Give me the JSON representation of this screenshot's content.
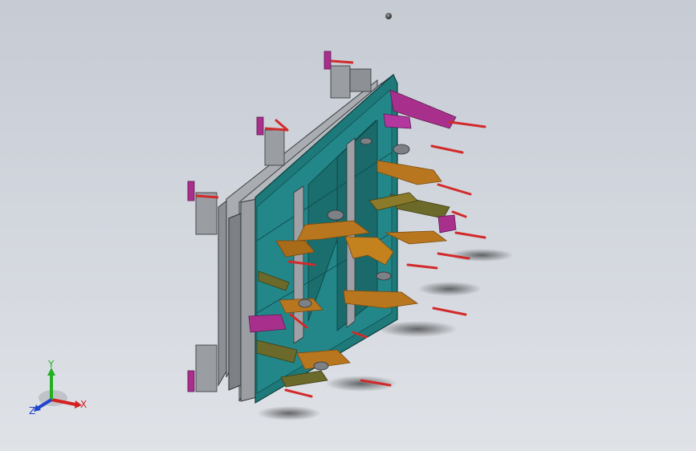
{
  "viewport": {
    "background_top": "#c6cbd4",
    "background_bottom": "#dfe2e7",
    "part_colors": {
      "frame_plate": "#1e7a7a",
      "frame_edge": "#0e4f4f",
      "steel": "#9a9ea3",
      "steel_dark": "#55595e",
      "bracket": "#b8761e",
      "bracket_dark": "#7a4a10",
      "clamp": "#a8308c",
      "clamp_dark": "#5e1a52",
      "olive": "#6b6a2a",
      "pin": "#d22a2a"
    }
  },
  "triad": {
    "x_label": "X",
    "y_label": "Y",
    "z_label": "Z",
    "x_color": "#d42222",
    "y_color": "#22b022",
    "z_color": "#2244cc"
  }
}
